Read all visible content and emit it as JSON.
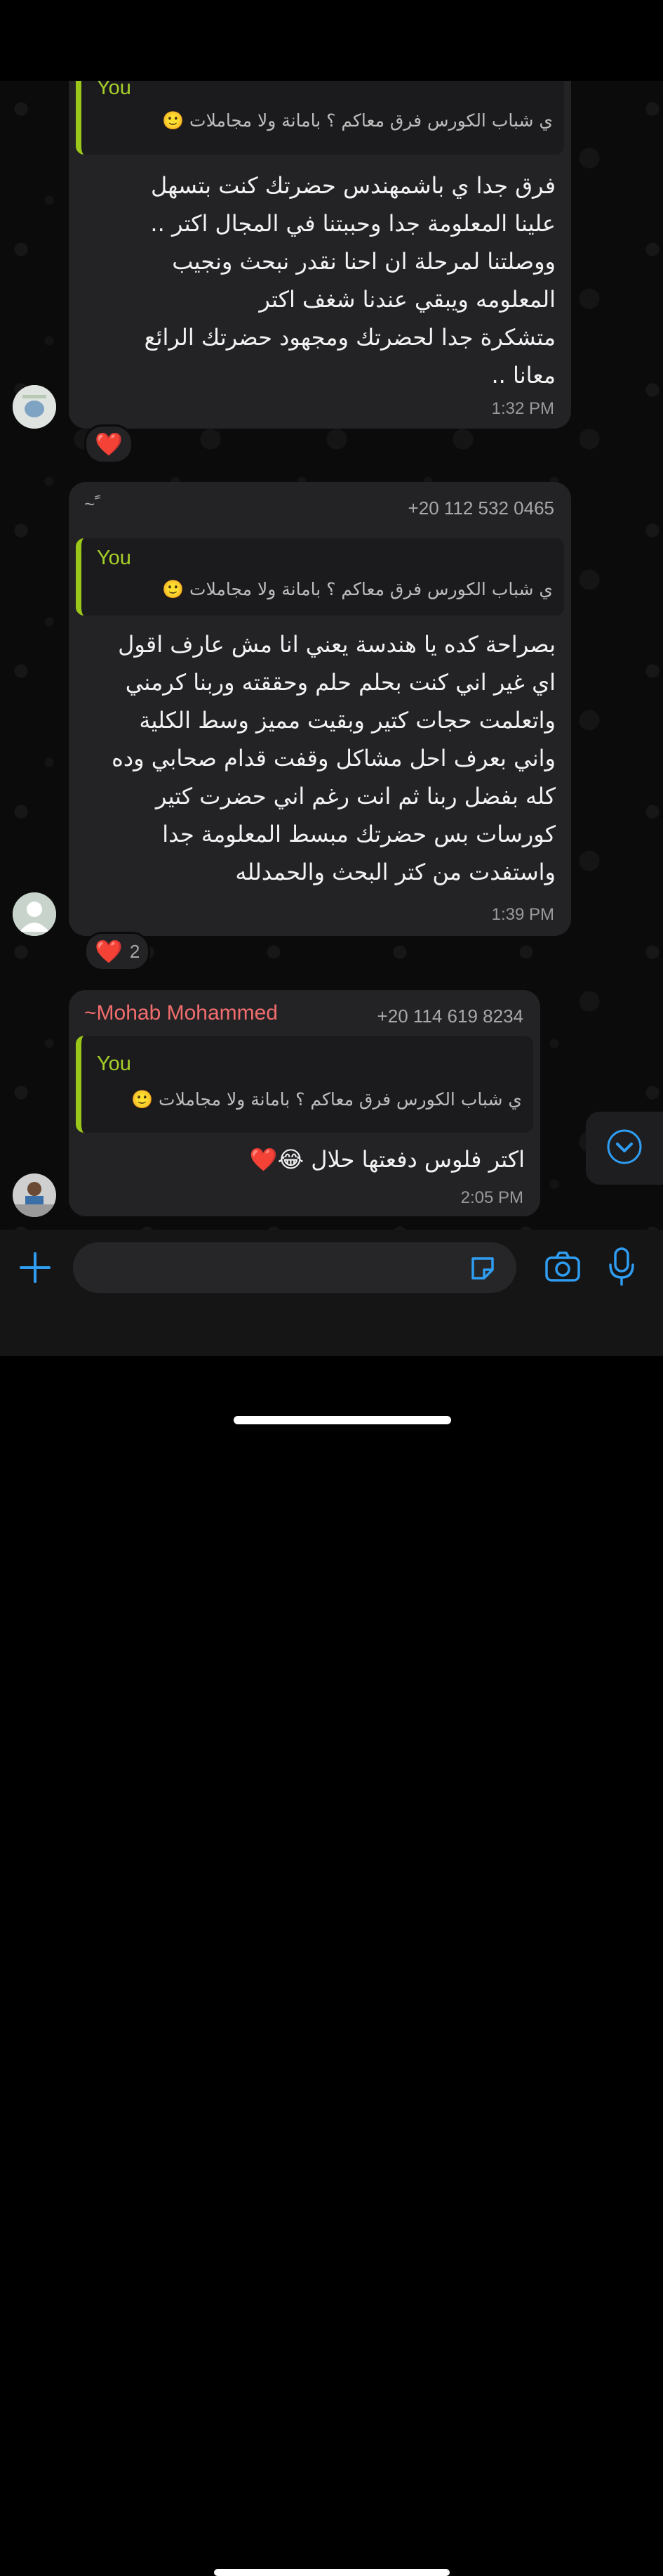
{
  "messages": [
    {
      "quote_author": "You",
      "quote_text": "ي شباب الكورس فرق معاكم ؟ بامانة ولا مجاملات 🙂",
      "text": "فرق جدا ي باشمهندس حضرتك كنت بتسهل\nعلينا المعلومة جدا وحببتنا في المجال اكتر ..\nووصلتنا لمرحلة ان احنا نقدر نبحث ونجيب\nالمعلومه ويبقي عندنا شغف اكتر\nمتشكرة جدا لحضرتك ومجهود حضرتك الرائع\nمعانا ..",
      "time": "1:32 PM",
      "reaction": "❤️",
      "reaction_count": ""
    },
    {
      "sender_name": "~ ً",
      "sender_phone": "+20 112 532 0465",
      "quote_author": "You",
      "quote_text": "ي شباب الكورس فرق معاكم ؟ بامانة ولا مجاملات 🙂",
      "text": "بصراحة كده يا هندسة يعني انا مش عارف اقول\nاي غير اني كنت بحلم حلم وحققته وربنا كرمني\nواتعلمت حجات كتير وبقيت مميز وسط الكلية\nواني بعرف احل مشاكل وقفت قدام صحابي وده\nكله بفضل ربنا ثم انت رغم اني حضرت كتير\nكورسات بس حضرتك مبسط المعلومة جدا\nواستفدت من كتر البحث والحمدلله",
      "time": "1:39 PM",
      "reaction": "❤️",
      "reaction_count": "2"
    },
    {
      "sender_name": "~Mohab Mohammed",
      "sender_phone": "+20 114 619 8234",
      "quote_author": "You",
      "quote_text": "ي شباب الكورس فرق معاكم ؟ بامانة ولا مجاملات 🙂",
      "text": "اكتر فلوس دفعتها حلال 😂❤️",
      "time": "2:05 PM"
    }
  ],
  "icons": {
    "add": "plus-icon",
    "sticker": "sticker-icon",
    "camera": "camera-icon",
    "mic": "microphone-icon",
    "scroll_down": "chevron-down-icon"
  },
  "colors": {
    "accent": "#2f9df2",
    "quote_bar": "#9bc71a",
    "sender_mohab": "#f26d6d",
    "heart": "#e3193b",
    "bubble": "#232326"
  },
  "composer": {
    "placeholder": ""
  }
}
